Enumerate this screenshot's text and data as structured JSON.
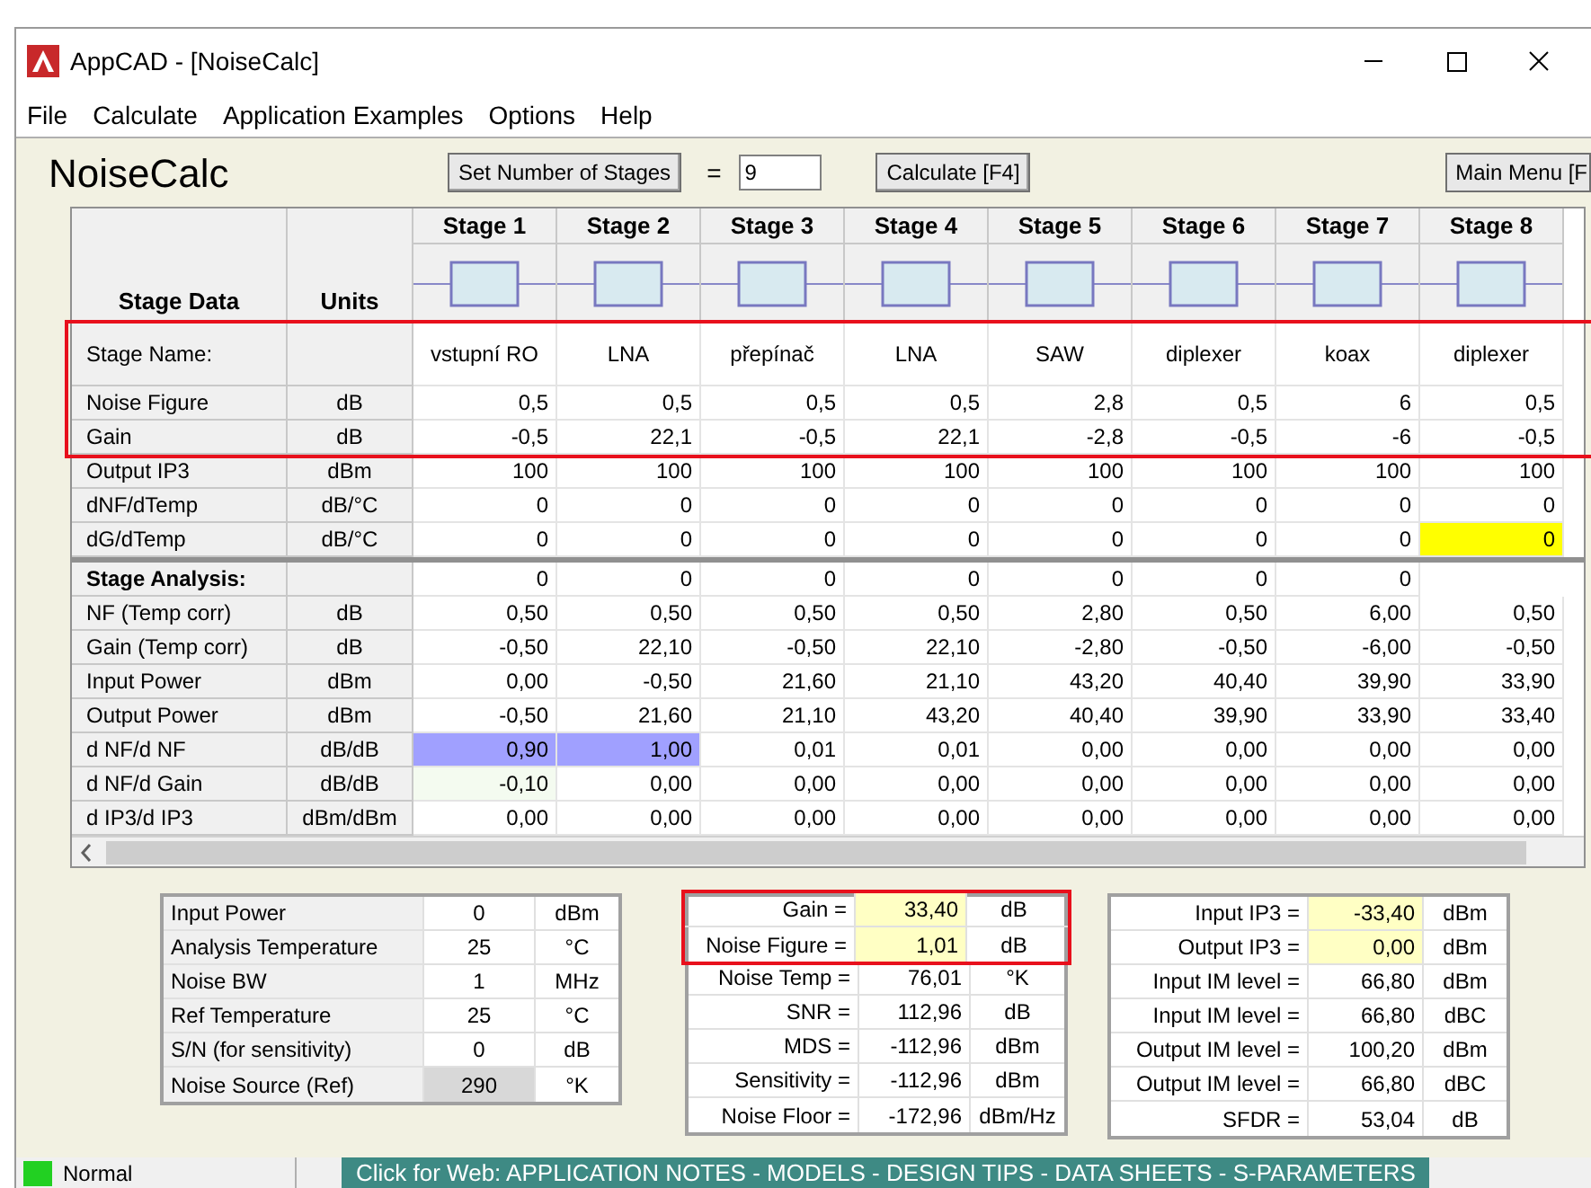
{
  "window": {
    "title": "AppCAD - [NoiseCalc]"
  },
  "menu": [
    "File",
    "Calculate",
    "Application Examples",
    "Options",
    "Help"
  ],
  "toolbar": {
    "title": "NoiseCalc",
    "set_stages_button": "Set Number of Stages",
    "equals": "=",
    "stages_value": "9",
    "calculate_button": "Calculate [F4]",
    "main_menu_button": "Main Menu [F"
  },
  "stage_table": {
    "label_heading": "Stage Data",
    "units_heading": "Units",
    "stages": [
      "Stage 1",
      "Stage 2",
      "Stage 3",
      "Stage 4",
      "Stage 5",
      "Stage 6",
      "Stage 7",
      "Stage 8"
    ],
    "data_rows": [
      {
        "label": "Stage Name:",
        "highlighted": true,
        "kind": "name",
        "cells": [
          "vstupní RO",
          "LNA",
          "přepínač",
          "LNA",
          "SAW",
          "diplexer",
          "koax",
          "diplexer"
        ]
      },
      {
        "label": "Noise Figure",
        "unit": "dB",
        "highlighted": true,
        "cells": [
          "0,5",
          "0,5",
          "0,5",
          "0,5",
          "2,8",
          "0,5",
          "6",
          "0,5"
        ]
      },
      {
        "label": "Gain",
        "unit": "dB",
        "highlighted": true,
        "cells": [
          "-0,5",
          "22,1",
          "-0,5",
          "22,1",
          "-2,8",
          "-0,5",
          "-6",
          "-0,5"
        ]
      },
      {
        "label": "Output IP3",
        "unit": "dBm",
        "highlighted": false,
        "cells": [
          "100",
          "100",
          "100",
          "100",
          "100",
          "100",
          "100",
          "100"
        ]
      },
      {
        "label": "dNF/dTemp",
        "unit": "dB/°C",
        "highlighted": false,
        "cells": [
          "0",
          "0",
          "0",
          "0",
          "0",
          "0",
          "0",
          "0"
        ]
      },
      {
        "label": "dG/dTemp",
        "unit": "dB/°C",
        "highlighted": false,
        "cells": [
          "0",
          "0",
          "0",
          "0",
          "0",
          "0",
          "0",
          {
            "text": "0",
            "color": "#ffff00"
          }
        ]
      }
    ],
    "analysis_heading": {
      "label": "Stage Analysis:",
      "cells": [
        "0",
        "0",
        "0",
        "0",
        "0",
        "0",
        "0"
      ]
    },
    "analysis_rows": [
      {
        "label": "NF (Temp corr)",
        "unit": "dB",
        "cells": [
          "0,50",
          "0,50",
          "0,50",
          "0,50",
          "2,80",
          "0,50",
          "6,00",
          "0,50"
        ]
      },
      {
        "label": "Gain (Temp corr)",
        "unit": "dB",
        "cells": [
          "-0,50",
          "22,10",
          "-0,50",
          "22,10",
          "-2,80",
          "-0,50",
          "-6,00",
          "-0,50"
        ]
      },
      {
        "label": "Input Power",
        "unit": "dBm",
        "cells": [
          "0,00",
          "-0,50",
          "21,60",
          "21,10",
          "43,20",
          "40,40",
          "39,90",
          "33,90"
        ]
      },
      {
        "label": "Output Power",
        "unit": "dBm",
        "cells": [
          "-0,50",
          "21,60",
          "21,10",
          "43,20",
          "40,40",
          "39,90",
          "33,90",
          "33,40"
        ]
      },
      {
        "label": "d NF/d NF",
        "unit": "dB/dB",
        "cells": [
          {
            "text": "0,90",
            "color": "#a0a0ff"
          },
          {
            "text": "1,00",
            "color": "#a0a0ff"
          },
          "0,01",
          "0,01",
          "0,00",
          "0,00",
          "0,00",
          "0,00"
        ]
      },
      {
        "label": "d NF/d Gain",
        "unit": "dB/dB",
        "cells": [
          {
            "text": "-0,10",
            "color": "#f4fbf0"
          },
          "0,00",
          "0,00",
          "0,00",
          "0,00",
          "0,00",
          "0,00",
          "0,00"
        ]
      },
      {
        "label": "d IP3/d IP3",
        "unit": "dBm/dBm",
        "cells": [
          "0,00",
          "0,00",
          "0,00",
          "0,00",
          "0,00",
          "0,00",
          "0,00",
          "0,00"
        ]
      }
    ]
  },
  "inputs": [
    {
      "label": "Input Power",
      "value": "0",
      "unit": "dBm",
      "readonly": false
    },
    {
      "label": "Analysis Temperature",
      "value": "25",
      "unit": "°C",
      "readonly": false
    },
    {
      "label": "Noise BW",
      "value": "1",
      "unit": "MHz",
      "readonly": false
    },
    {
      "label": "Ref Temperature",
      "value": "25",
      "unit": "°C",
      "readonly": false
    },
    {
      "label": "S/N (for sensitivity)",
      "value": "0",
      "unit": "dB",
      "readonly": false
    },
    {
      "label": "Noise Source (Ref)",
      "value": "290",
      "unit": "°K",
      "readonly": true
    }
  ],
  "results": [
    {
      "label": "Gain =",
      "value": "33,40",
      "unit": "dB",
      "emphasized": true,
      "framed": true
    },
    {
      "label": "Noise Figure =",
      "value": "1,01",
      "unit": "dB",
      "emphasized": true,
      "framed": true
    },
    {
      "label": "Noise Temp =",
      "value": "76,01",
      "unit": "°K",
      "emphasized": false,
      "framed": false
    },
    {
      "label": "SNR =",
      "value": "112,96",
      "unit": "dB",
      "emphasized": false,
      "framed": false
    },
    {
      "label": "MDS =",
      "value": "-112,96",
      "unit": "dBm",
      "emphasized": false,
      "framed": false
    },
    {
      "label": "Sensitivity =",
      "value": "-112,96",
      "unit": "dBm",
      "emphasized": false,
      "framed": false
    },
    {
      "label": "Noise Floor =",
      "value": "-172,96",
      "unit": "dBm/Hz",
      "emphasized": false,
      "framed": false
    }
  ],
  "ip3_results": [
    {
      "label": "Input IP3 =",
      "value": "-33,40",
      "unit": "dBm",
      "emphasized": true
    },
    {
      "label": "Output IP3 =",
      "value": "0,00",
      "unit": "dBm",
      "emphasized": true
    },
    {
      "label": "Input IM level =",
      "value": "66,80",
      "unit": "dBm",
      "emphasized": false
    },
    {
      "label": "Input IM level =",
      "value": "66,80",
      "unit": "dBC",
      "emphasized": false
    },
    {
      "label": "Output IM level =",
      "value": "100,20",
      "unit": "dBm",
      "emphasized": false
    },
    {
      "label": "Output IM level =",
      "value": "66,80",
      "unit": "dBC",
      "emphasized": false
    },
    {
      "label": "SFDR =",
      "value": "53,04",
      "unit": "dB",
      "emphasized": false
    }
  ],
  "status_bar": {
    "mode": "Normal",
    "web_banner": "Click for Web: APPLICATION NOTES - MODELS - DESIGN TIPS - DATA SHEETS - S-PARAMETERS"
  }
}
